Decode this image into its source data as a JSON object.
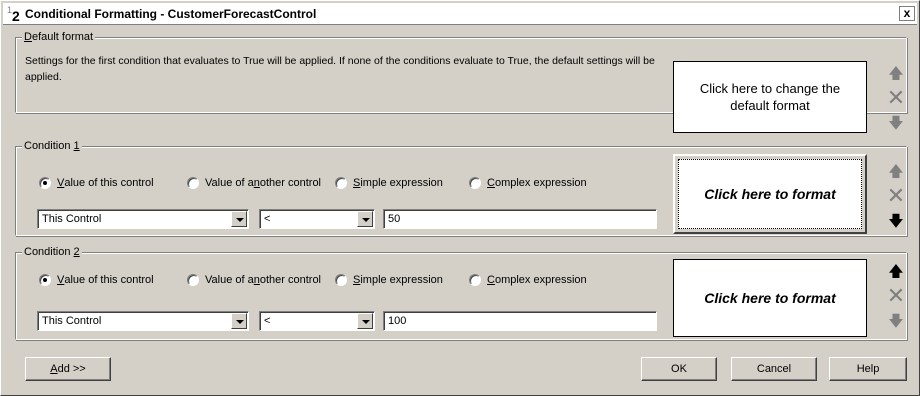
{
  "window": {
    "icon_sup": "1",
    "icon_big": "2",
    "title": "Conditional Formatting - CustomerForecastControl",
    "close_label": "x"
  },
  "default_format": {
    "group_title_u": "D",
    "group_title_rest": "efault format",
    "description": "Settings for the first condition that evaluates to True will be applied. If none of the conditions evaluate to True, the default settings will be applied.",
    "preview_text": "Click here to change the default format"
  },
  "conditions": [
    {
      "title_prefix": "Condition ",
      "title_u": "1",
      "radios": [
        {
          "u": "V",
          "rest": "alue of this control",
          "selected": true
        },
        {
          "pre": "Value of a",
          "u": "n",
          "rest": "other control",
          "selected": false
        },
        {
          "u": "S",
          "rest": "imple expression",
          "selected": false
        },
        {
          "u": "C",
          "rest": "omplex expression",
          "selected": false
        }
      ],
      "field": "This Control",
      "operator": "<",
      "value": "50",
      "preview_text": "Click here to format"
    },
    {
      "title_prefix": "Condition ",
      "title_u": "2",
      "radios": [
        {
          "u": "V",
          "rest": "alue of this control",
          "selected": true
        },
        {
          "pre": "Value of a",
          "u": "n",
          "rest": "other control",
          "selected": false
        },
        {
          "u": "S",
          "rest": "imple expression",
          "selected": false
        },
        {
          "u": "C",
          "rest": "omplex expression",
          "selected": false
        }
      ],
      "field": "This Control",
      "operator": "<",
      "value": "100",
      "preview_text": "Click here to format"
    }
  ],
  "side_icons": {
    "up": "🡅",
    "delete": "✕",
    "down": "🡇"
  },
  "buttons": {
    "add_u": "A",
    "add_rest": "dd >>",
    "ok": "OK",
    "cancel": "Cancel",
    "help": "Help"
  }
}
